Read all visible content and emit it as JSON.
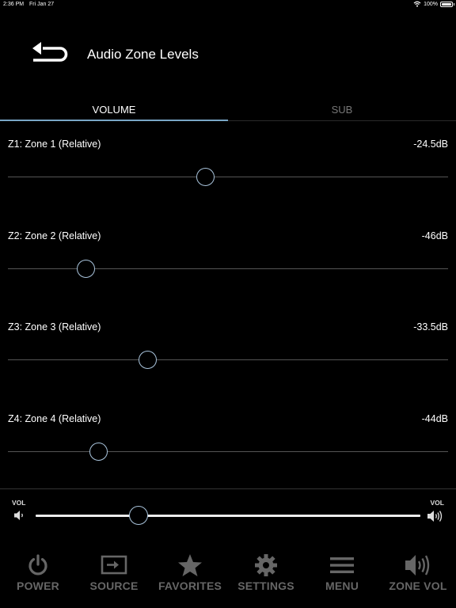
{
  "status_bar": {
    "time": "2:36 PM",
    "date": "Fri Jan 27",
    "battery": "100%"
  },
  "header": {
    "title": "Audio Zone Levels"
  },
  "tabs": [
    {
      "label": "VOLUME",
      "active": true
    },
    {
      "label": "SUB",
      "active": false
    }
  ],
  "zones": [
    {
      "label": "Z1: Zone 1 (Relative)",
      "value": "-24.5dB",
      "level": 0.448
    },
    {
      "label": "Z2: Zone 2 (Relative)",
      "value": "-46dB",
      "level": 0.177
    },
    {
      "label": "Z3: Zone 3 (Relative)",
      "value": "-33.5dB",
      "level": 0.318
    },
    {
      "label": "Z4: Zone 4 (Relative)",
      "value": "-44dB",
      "level": 0.206
    }
  ],
  "master_volume": {
    "label_left": "VOL",
    "label_right": "VOL",
    "level": 0.268
  },
  "nav": [
    {
      "label": "POWER",
      "icon": "power-icon"
    },
    {
      "label": "SOURCE",
      "icon": "source-icon"
    },
    {
      "label": "FAVORITES",
      "icon": "star-icon"
    },
    {
      "label": "SETTINGS",
      "icon": "gear-icon"
    },
    {
      "label": "MENU",
      "icon": "menu-icon"
    },
    {
      "label": "ZONE VOL",
      "icon": "zone-volume-icon"
    }
  ],
  "colors": {
    "accent": "#79a6c6",
    "thumb_border": "#a9c4dc",
    "nav_inactive": "#666666"
  }
}
